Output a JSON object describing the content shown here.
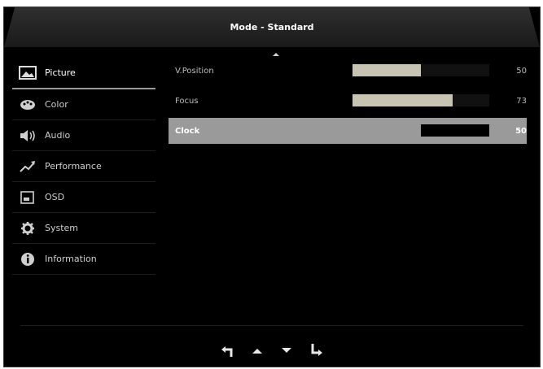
{
  "header": {
    "title": "Mode - Standard"
  },
  "sidebar": {
    "items": [
      {
        "label": "Picture",
        "icon": "picture-icon",
        "active": true
      },
      {
        "label": "Color",
        "icon": "palette-icon"
      },
      {
        "label": "Audio",
        "icon": "speaker-icon"
      },
      {
        "label": "Performance",
        "icon": "trend-icon"
      },
      {
        "label": "OSD",
        "icon": "osd-icon"
      },
      {
        "label": "System",
        "icon": "gear-icon"
      },
      {
        "label": "Information",
        "icon": "info-icon"
      }
    ]
  },
  "settings": [
    {
      "label": "V.Position",
      "value": "50",
      "level": 0.5
    },
    {
      "label": "Focus",
      "value": "73",
      "level": 0.73
    },
    {
      "label": "Clock",
      "value": "50",
      "level": 0.5,
      "selected": true
    }
  ],
  "footer": {
    "buttons": [
      "back-icon",
      "arrow-up-icon",
      "arrow-down-icon",
      "enter-icon"
    ]
  },
  "colors": {
    "background": "#000000",
    "selection": "#9a9a9a",
    "bar_fill": "#c8c4b4"
  }
}
